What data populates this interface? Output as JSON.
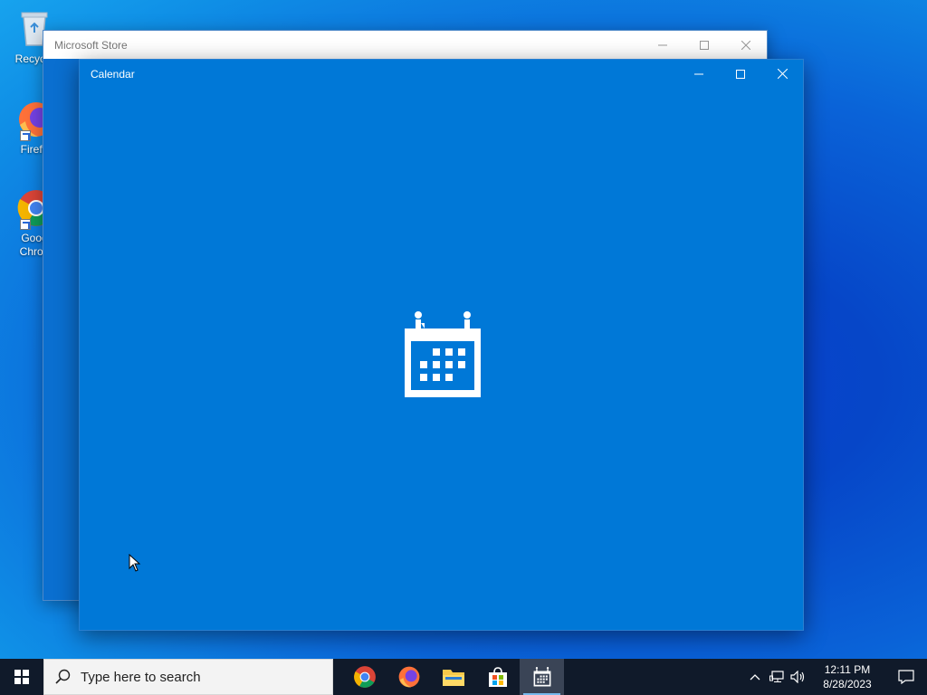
{
  "desktop": {
    "icons": [
      {
        "label": "Recycle"
      },
      {
        "label": "Firefo"
      },
      {
        "label": "Goog",
        "label2": "Chron"
      }
    ]
  },
  "windows": {
    "store": {
      "title": "Microsoft Store"
    },
    "calendar": {
      "title": "Calendar"
    }
  },
  "taskbar": {
    "search_placeholder": "Type here to search",
    "apps": [
      "chrome-icon",
      "firefox-icon",
      "file-explorer-icon",
      "microsoft-store-icon",
      "calendar-icon"
    ],
    "active_app": "calendar-icon",
    "clock": {
      "time": "12:11 PM",
      "date": "8/28/2023"
    }
  },
  "colors": {
    "calendar_accent": "#0078d7",
    "taskbar": "#101a2a"
  }
}
